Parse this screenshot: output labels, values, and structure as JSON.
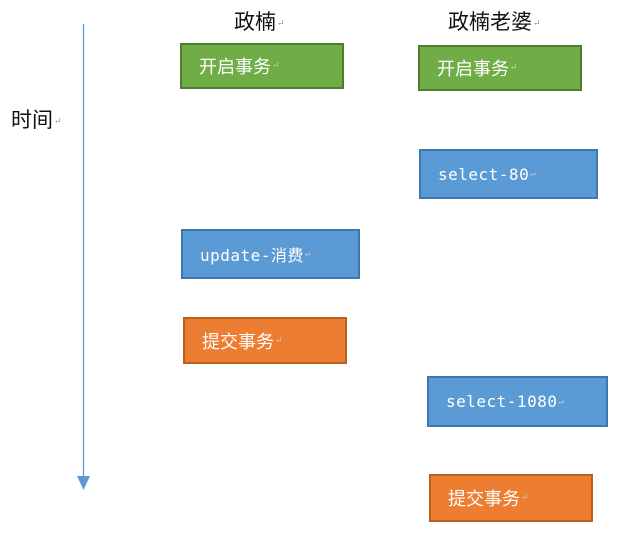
{
  "colors": {
    "start": "#70ad47",
    "query": "#5b9bd5",
    "commit": "#ed7d31",
    "timeline": "#5b9bd5"
  },
  "time_axis": {
    "label": "时间"
  },
  "columns": [
    {
      "header": "政楠"
    },
    {
      "header": "政楠老婆"
    }
  ],
  "steps": {
    "a_start": "开启事务",
    "a_update": "update-消费",
    "a_commit": "提交事务",
    "b_start": "开启事务",
    "b_select1": "select-80",
    "b_select2": "select-1080",
    "b_commit": "提交事务"
  },
  "paragraph_mark": "↵"
}
